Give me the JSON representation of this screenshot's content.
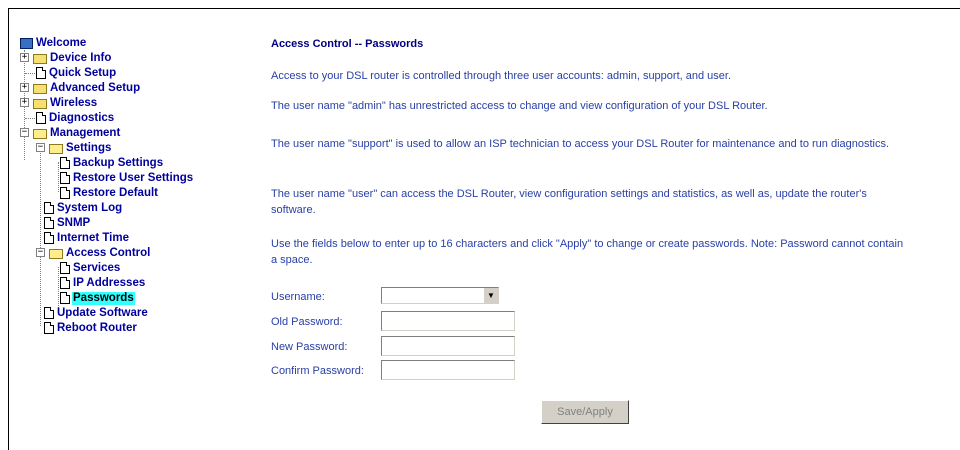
{
  "nav": {
    "welcome": "Welcome",
    "device_info": "Device Info",
    "quick_setup": "Quick Setup",
    "advanced_setup": "Advanced Setup",
    "wireless": "Wireless",
    "diagnostics": "Diagnostics",
    "management": "Management",
    "settings": "Settings",
    "backup_settings": "Backup Settings",
    "restore_user_settings": "Restore User Settings",
    "restore_default": "Restore Default",
    "system_log": "System Log",
    "snmp": "SNMP",
    "internet_time": "Internet Time",
    "access_control": "Access Control",
    "services": "Services",
    "ip_addresses": "IP Addresses",
    "passwords": "Passwords",
    "update_software": "Update Software",
    "reboot_router": "Reboot Router"
  },
  "main": {
    "title": "Access Control -- Passwords",
    "p1": "Access to your DSL router is controlled through three user accounts: admin, support, and user.",
    "p2": "The user name \"admin\" has unrestricted access to change and view configuration of your DSL Router.",
    "p3": "The user name \"support\" is used to allow an ISP technician to access your DSL Router for maintenance and to run diagnostics.",
    "p4": "The user name \"user\" can access the DSL Router, view configuration settings and statistics, as well as, update the router's software.",
    "p5": "Use the fields below to enter up to 16 characters and click \"Apply\" to change or create passwords. Note: Password cannot contain a space."
  },
  "form": {
    "username_label": "Username:",
    "username_value": "",
    "old_password_label": "Old Password:",
    "new_password_label": "New Password:",
    "confirm_password_label": "Confirm Password:",
    "save_label": "Save/Apply"
  },
  "icons": {
    "dropdown": "chevron-down-icon",
    "page": "page-icon",
    "folder": "folder-icon",
    "computer": "computer-icon"
  }
}
